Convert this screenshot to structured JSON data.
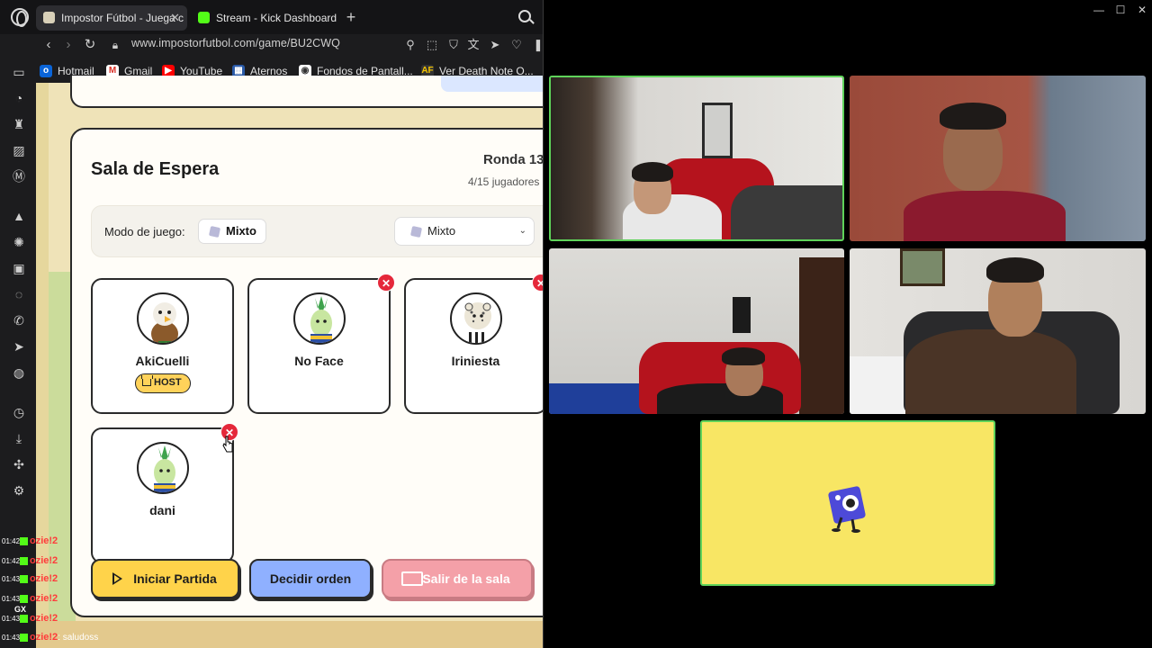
{
  "browser": {
    "tabs": [
      {
        "label": "Impostor Fútbol - Juega c",
        "active": true
      },
      {
        "label": "Stream - Kick Dashboard",
        "active": false
      }
    ],
    "url": "www.impostorfutbol.com/game/BU2CWQ",
    "bookmarks": [
      "Hotmail",
      "Gmail",
      "YouTube",
      "Aternos",
      "Fondos de Pantall...",
      "Ver Death Note O..."
    ]
  },
  "chat": {
    "rows": [
      {
        "time": "01:42",
        "user": "ozie!2",
        "msg": ""
      },
      {
        "time": "01:42",
        "user": "ozie!2",
        "msg": ""
      },
      {
        "time": "01:43",
        "user": "ozie!2",
        "msg": ""
      },
      {
        "time": "01:43",
        "user": "ozie!2",
        "msg": ""
      },
      {
        "time": "01:43",
        "user": "ozie!2",
        "msg": ""
      },
      {
        "time": "01:43",
        "user": "ozie!2",
        "msg": ": saludoss"
      }
    ],
    "gx": "GX"
  },
  "lobby": {
    "title": "Sala de Espera",
    "round": "Ronda 13",
    "players_count": "4/15 jugadores",
    "mode_label": "Modo de juego:",
    "mode_value": "Mixto",
    "mode_select": "Mixto",
    "players": [
      {
        "name": "AkiCuelli",
        "host": true,
        "host_label": "HOST",
        "avatar": "eagle-avatar"
      },
      {
        "name": "No Face",
        "host": false,
        "avatar": "leek-avatar"
      },
      {
        "name": "Iriniesta",
        "host": false,
        "avatar": "leopard-avatar"
      },
      {
        "name": "dani",
        "host": false,
        "avatar": "leek-avatar"
      }
    ],
    "buttons": {
      "start": "Iniciar Partida",
      "order": "Decidir orden",
      "leave": "Salir de la sala"
    }
  },
  "colors": {
    "start_button": "#ffd34a",
    "order_button": "#8fb0ff",
    "leave_button": "#f4a0a8",
    "kick_badge": "#e5283a",
    "active_speaker": "#5fd35a",
    "call_placeholder": "#f8e664"
  }
}
